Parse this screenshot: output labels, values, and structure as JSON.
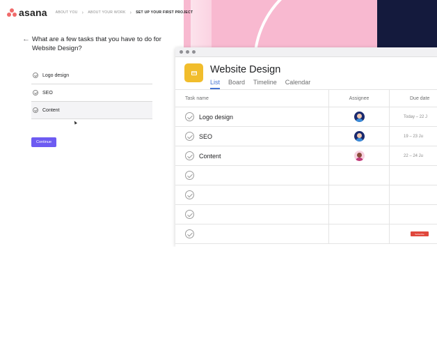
{
  "brand": {
    "logo_text": "asana"
  },
  "onboarding": {
    "steps": [
      "ABOUT YOU",
      "ABOUT YOUR WORK",
      "SET UP YOUR FIRST PROJECT"
    ],
    "active_step": 2,
    "question": "What are a few tasks that you have to do for Website Design?",
    "task_inputs": [
      "Logo design",
      "SEO",
      "Content"
    ],
    "continue_label": "Continue"
  },
  "project": {
    "title": "Website Design",
    "icon": "calendar-icon",
    "tabs": [
      "List",
      "Board",
      "Timeline",
      "Calendar"
    ],
    "active_tab": "List",
    "columns": {
      "name": "Task name",
      "assignee": "Assignee",
      "due": "Due date"
    },
    "rows": [
      {
        "name": "Logo design",
        "assignee_avatar": "avatar-blue",
        "due": "Today – 22 J"
      },
      {
        "name": "SEO",
        "assignee_avatar": "avatar-blue",
        "due": "19 – 23 Ju"
      },
      {
        "name": "Content",
        "assignee_avatar": "avatar-pink",
        "due": "22 – 24 Ju"
      },
      {
        "name": "",
        "assignee_avatar": "",
        "due": ""
      },
      {
        "name": "",
        "assignee_avatar": "",
        "due": ""
      },
      {
        "name": "",
        "assignee_avatar": "",
        "due": ""
      },
      {
        "name": "",
        "assignee_avatar": "",
        "due": ""
      }
    ],
    "subscribe_badge": "Subscribe"
  },
  "colors": {
    "accent": "#6d5bf2",
    "tab_active": "#4573d2",
    "project_icon": "#f1bd2c",
    "pink_bg": "#f8b9d0",
    "navy_bg": "#141a3d",
    "logo": "#f06a6a"
  }
}
